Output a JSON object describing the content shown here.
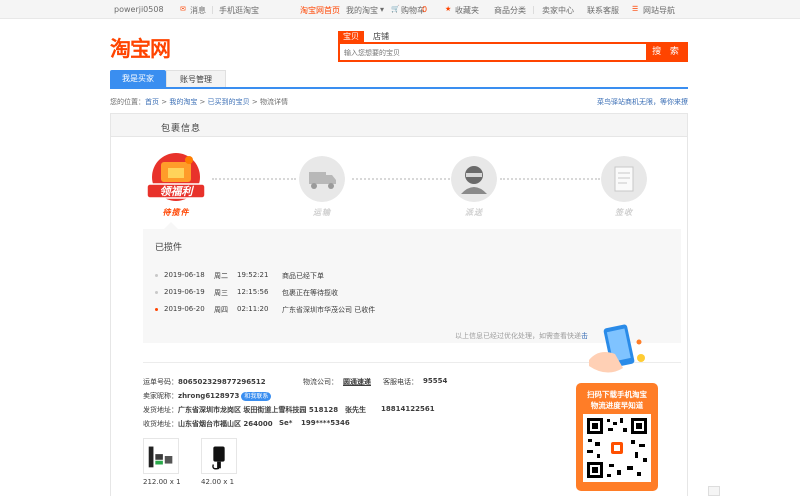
{
  "topnav": {
    "username": "powerji0508",
    "messages": "消息",
    "mobile": "手机逛淘宝",
    "home": "淘宝网首页",
    "my_taobao": "我的淘宝",
    "cart_label": "购物车",
    "cart_count": "0",
    "favorites": "收藏夹",
    "categories": "商品分类",
    "seller": "卖家中心",
    "service": "联系客服",
    "sitemap": "网站导航"
  },
  "header": {
    "logo": "淘宝网",
    "search_tabs": [
      "宝贝",
      "店铺"
    ],
    "search_placeholder": "输入您想要的宝贝",
    "search_button": "搜 索"
  },
  "role_tabs": [
    "我是买家",
    "账号管理"
  ],
  "breadcrumb": {
    "prefix": "您的位置：",
    "items": [
      "首页",
      "我的淘宝",
      "已买到的宝贝"
    ],
    "separator": " > ",
    "current": "物流详情"
  },
  "notice": "菜鸟驿站商机无限，等你来撩",
  "panel_title": "包裹信息",
  "steps": [
    {
      "label": "待揽件",
      "active": true,
      "promo": "领福利"
    },
    {
      "label": "运输",
      "active": false
    },
    {
      "label": "派送",
      "active": false
    },
    {
      "label": "签收",
      "active": false
    }
  ],
  "timeline": {
    "heading": "已揽件",
    "events": [
      {
        "date": "2019-06-18",
        "weekday": "周二",
        "time": "19:52:21",
        "message": "商品已经下单"
      },
      {
        "date": "2019-06-19",
        "weekday": "周三",
        "time": "12:15:56",
        "message": "包裹正在等待揽收"
      },
      {
        "date": "2019-06-20",
        "weekday": "周四",
        "time": "02:11:20",
        "message": "广东省深圳市华茂公司 已收件"
      }
    ],
    "footnote": "以上信息已经过优化处理，如需查看快递",
    "footnote_link": "击"
  },
  "order": {
    "tracking_label": "运单号码：",
    "tracking_no": "806502329877296512",
    "carrier_label": "物流公司：",
    "carrier": "圆通速递",
    "phone_label": "客服电话：",
    "carrier_phone": "95554",
    "seller_label": "卖家昵称：",
    "seller": "zhrong6128973",
    "contact_badge": "和我联系",
    "ship_label": "发货地址：",
    "ship_addr": "广东省深圳市龙岗区 坂田街道上雪科技园 518128",
    "ship_name": "张先生",
    "ship_phone": "18814122561",
    "recv_label": "收货地址：",
    "recv_addr": "山东省烟台市福山区 264000",
    "recv_name": "Se*",
    "recv_phone": "199****5346"
  },
  "goods": [
    {
      "price": "212.00 x 1"
    },
    {
      "price": "42.00 x 1"
    }
  ],
  "promo": {
    "line1": "扫码下载手机淘宝",
    "line2": "物流进度早知道"
  },
  "colors": {
    "accent": "#ff4400",
    "link": "#3a6eb5",
    "tab_blue": "#3a8ef0",
    "promo_orange": "#ff7d27"
  }
}
